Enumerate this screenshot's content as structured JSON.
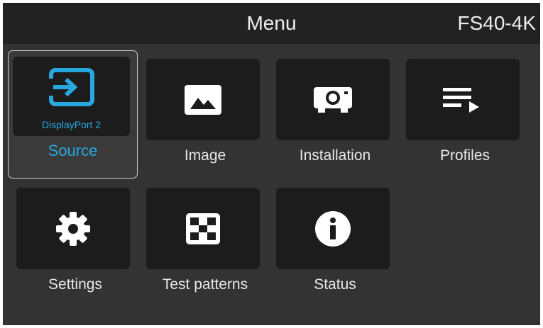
{
  "header": {
    "title": "Menu",
    "model": "FS40-4K"
  },
  "tiles": [
    {
      "label": "Source",
      "sublabel": "DisplayPort 2",
      "icon": "source-input-icon",
      "selected": true
    },
    {
      "label": "Image",
      "icon": "image-icon"
    },
    {
      "label": "Installation",
      "icon": "projector-icon"
    },
    {
      "label": "Profiles",
      "icon": "playlist-icon"
    },
    {
      "label": "Settings",
      "icon": "gear-icon"
    },
    {
      "label": "Test patterns",
      "icon": "checkerboard-icon"
    },
    {
      "label": "Status",
      "icon": "info-icon"
    }
  ],
  "colors": {
    "accent": "#29a8e0",
    "background": "#333333",
    "header": "#222222",
    "tile": "#1c1c1c"
  }
}
